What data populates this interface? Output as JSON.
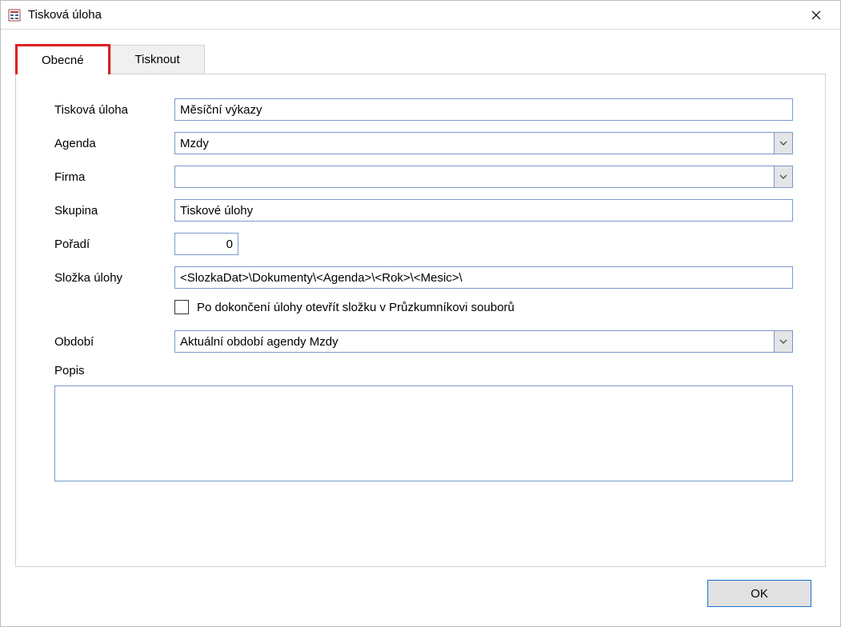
{
  "window": {
    "title": "Tisková úloha"
  },
  "tabs": {
    "general": "Obecné",
    "print": "Tisknout"
  },
  "form": {
    "task_label": "Tisková úloha",
    "task_value": "Měsíční výkazy",
    "agenda_label": "Agenda",
    "agenda_value": "Mzdy",
    "company_label": "Firma",
    "company_value": "",
    "group_label": "Skupina",
    "group_value": "Tiskové úlohy",
    "order_label": "Pořadí",
    "order_value": "0",
    "folder_label": "Složka úlohy",
    "folder_value": "<SlozkaDat>\\Dokumenty\\<Agenda>\\<Rok>\\<Mesic>\\",
    "openfolder_label": "Po dokončení úlohy otevřít složku v Průzkumníkovi souborů",
    "period_label": "Období",
    "period_value": "Aktuální období agendy Mzdy",
    "desc_label": "Popis",
    "desc_value": ""
  },
  "buttons": {
    "ok": "OK"
  }
}
